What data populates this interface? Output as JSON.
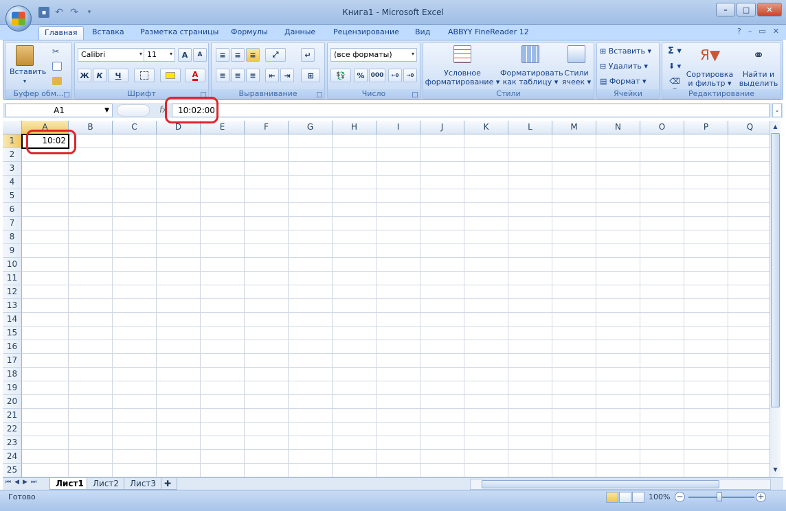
{
  "window": {
    "title": "Книга1 - Microsoft Excel",
    "minimize": "–",
    "maximize": "□",
    "close": "✕"
  },
  "ribbon_tabs": [
    "Главная",
    "Вставка",
    "Разметка страницы",
    "Формулы",
    "Данные",
    "Рецензирование",
    "Вид",
    "ABBYY FineReader 12"
  ],
  "active_tab": "Главная",
  "groups": {
    "clipboard": {
      "label": "Буфер обм...",
      "paste": "Вставить"
    },
    "font": {
      "label": "Шрифт",
      "font_name": "Calibri",
      "font_size": "11",
      "bold": "Ж",
      "italic": "К",
      "underline": "Ч",
      "grow": "A",
      "shrink": "A"
    },
    "alignment": {
      "label": "Выравнивание"
    },
    "number": {
      "label": "Число",
      "format": "(все форматы)",
      "percent": "%",
      "thousands": "000"
    },
    "styles": {
      "label": "Стили",
      "conditional": "Условное форматирование",
      "as_table": "Форматировать как таблицу",
      "cell_styles": "Стили ячеек"
    },
    "cells": {
      "label": "Ячейки",
      "insert": "Вставить",
      "delete": "Удалить",
      "format": "Формат"
    },
    "editing": {
      "label": "Редактирование",
      "sum": "Σ",
      "sort": "Сортировка и фильтр",
      "find": "Найти и выделить"
    }
  },
  "formula_bar": {
    "name_box": "A1",
    "fx": "fx",
    "formula": "10:02:00"
  },
  "columns": [
    "A",
    "B",
    "C",
    "D",
    "E",
    "F",
    "G",
    "H",
    "I",
    "J",
    "K",
    "L",
    "M",
    "N",
    "O",
    "P",
    "Q"
  ],
  "rows": [
    "1",
    "2",
    "3",
    "4",
    "5",
    "6",
    "7",
    "8",
    "9",
    "10",
    "11",
    "12",
    "13",
    "14",
    "15",
    "16",
    "17",
    "18",
    "19",
    "20",
    "21",
    "22",
    "23",
    "24",
    "25"
  ],
  "cells": {
    "A1": "10:02"
  },
  "sheets": [
    "Лист1",
    "Лист2",
    "Лист3"
  ],
  "active_sheet": "Лист1",
  "status": {
    "ready": "Готово",
    "zoom": "100%"
  },
  "colors": {
    "highlight": "#e0242b",
    "ribbon": "#c8dbf5"
  }
}
